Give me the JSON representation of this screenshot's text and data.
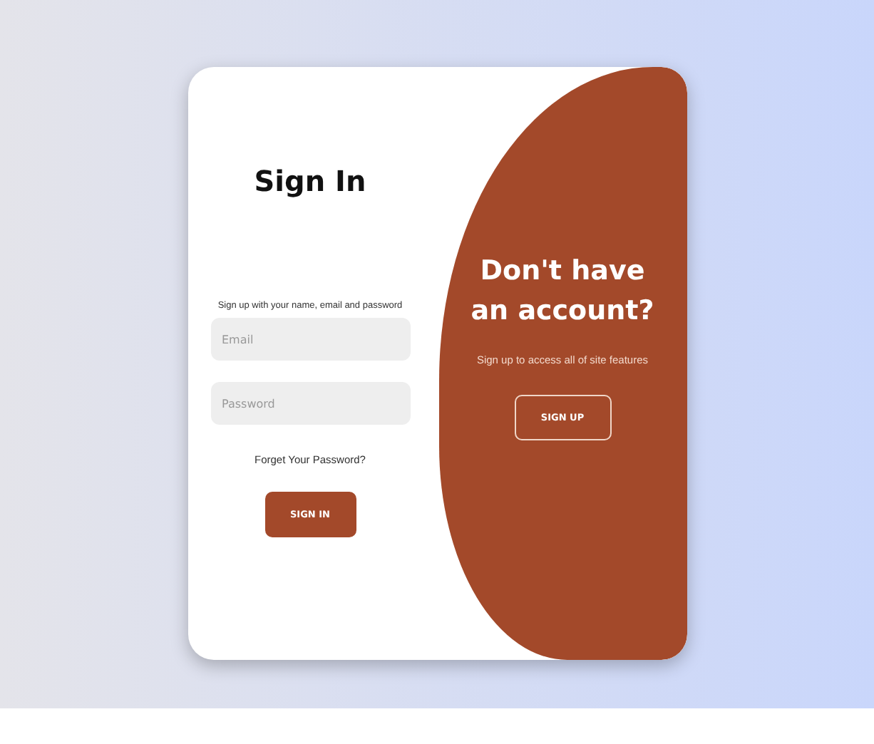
{
  "sign_in": {
    "title": "Sign In",
    "subtitle": "Sign up with your name, email and password",
    "fields": [
      {
        "placeholder": "Email"
      },
      {
        "placeholder": "Password"
      }
    ],
    "forgot_link": "Forget Your Password?",
    "button": "SIGN IN"
  },
  "sign_up_panel": {
    "title": "Don't have an account?",
    "subtitle": "Sign up to access all of site features",
    "button": "SIGN UP"
  }
}
